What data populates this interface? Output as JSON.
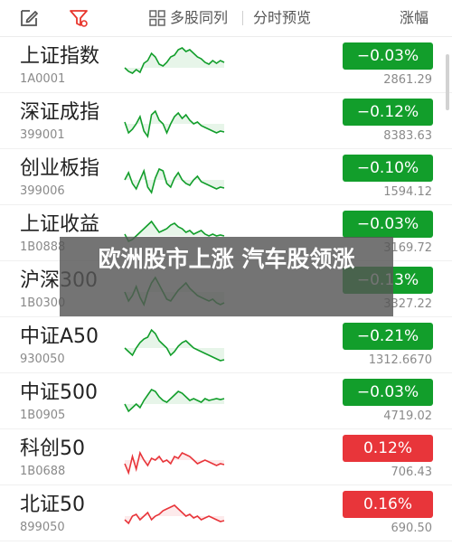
{
  "toolbar": {
    "edit_icon": "edit-icon",
    "filter_icon": "filter-icon",
    "grid_icon": "grid-icon",
    "view_label": "多股同列",
    "intraday_label": "分时预览",
    "sort_label": "涨幅",
    "filter_color": "#e8352c"
  },
  "colors": {
    "up": "#e8353a",
    "down": "#129e2b"
  },
  "rows": [
    {
      "name": "上证指数",
      "code": "1A0001",
      "change": "−0.03%",
      "price": "2861.29",
      "trend": "down"
    },
    {
      "name": "深证成指",
      "code": "399001",
      "change": "−0.12%",
      "price": "8383.63",
      "trend": "down"
    },
    {
      "name": "创业板指",
      "code": "399006",
      "change": "−0.10%",
      "price": "1594.12",
      "trend": "down"
    },
    {
      "name": "上证收益",
      "code": "1B0888",
      "change": "−0.03%",
      "price": "3169.72",
      "trend": "down"
    },
    {
      "name": "沪深300",
      "code": "1B0300",
      "change": "−0.13%",
      "price": "3327.22",
      "trend": "down"
    },
    {
      "name": "中证A50",
      "code": "930050",
      "change": "−0.21%",
      "price": "1312.6670",
      "trend": "down"
    },
    {
      "name": "中证500",
      "code": "1B0905",
      "change": "−0.03%",
      "price": "4719.02",
      "trend": "down"
    },
    {
      "name": "科创50",
      "code": "1B0688",
      "change": "0.12%",
      "price": "706.43",
      "trend": "up"
    },
    {
      "name": "北证50",
      "code": "899050",
      "change": "0.16%",
      "price": "690.50",
      "trend": "up"
    }
  ],
  "overlay": {
    "headline": "欧洲股市上涨 汽车股领涨"
  }
}
